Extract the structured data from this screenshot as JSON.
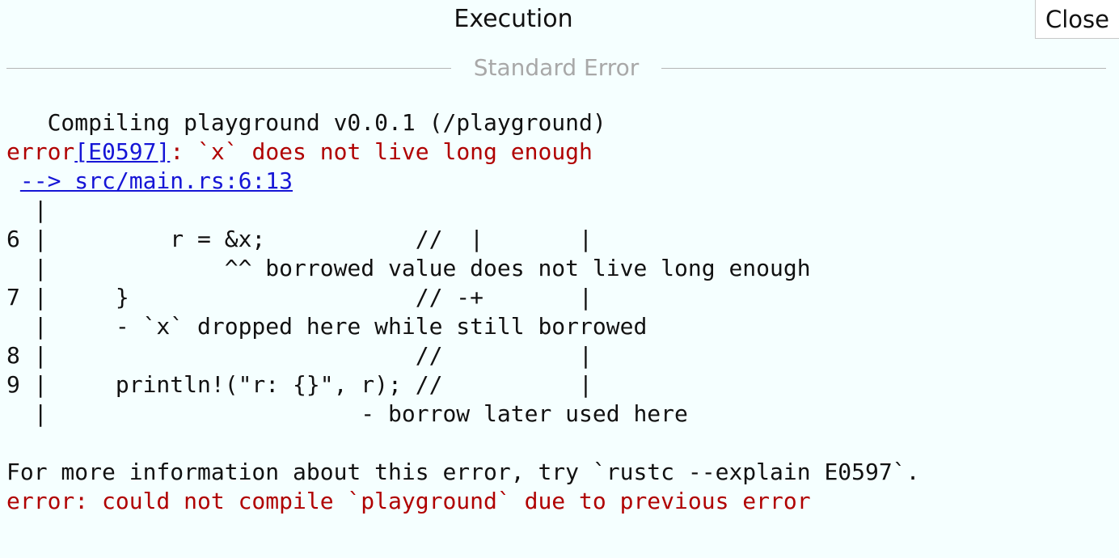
{
  "header": {
    "title": "Execution",
    "close_label": "Close"
  },
  "section": {
    "label": "Standard Error"
  },
  "stderr": {
    "compiling": "   Compiling playground v0.0.1 (/playground)",
    "error_prefix": "error",
    "error_code": "[E0597]",
    "error_message": ": `x` does not live long enough",
    "location_indent": " ",
    "location": "--> src/main.rs:6:13",
    "code_lines": [
      "  |",
      "6 |         r = &x;           //  |       |",
      "  |             ^^ borrowed value does not live long enough",
      "7 |     }                     // -+       |",
      "  |     - `x` dropped here while still borrowed",
      "8 |                           //          |",
      "9 |     println!(\"r: {}\", r); //          |",
      "  |                       - borrow later used here",
      ""
    ],
    "more_info": "For more information about this error, try `rustc --explain E0597`.",
    "final_error": "error: could not compile `playground` due to previous error"
  },
  "colors": {
    "background": "#f5ffff",
    "error": "#b00000",
    "link": "#1515d6",
    "muted": "#a8a8a8"
  }
}
